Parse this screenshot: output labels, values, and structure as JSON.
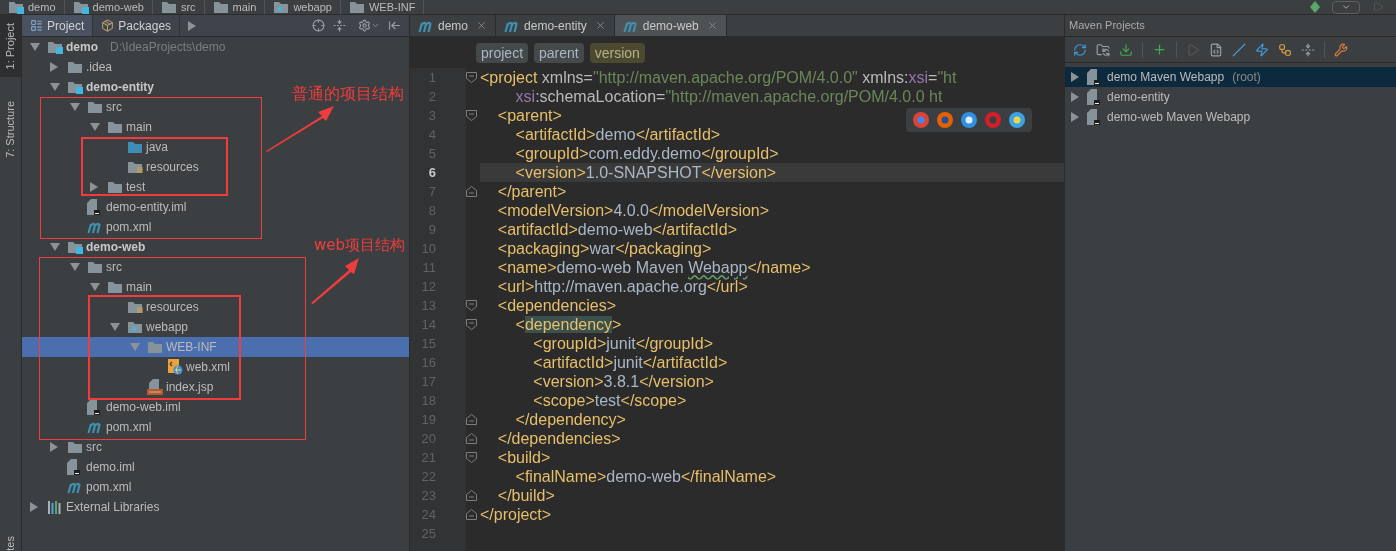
{
  "breadcrumbs": [
    {
      "label": "demo",
      "kind": "module"
    },
    {
      "label": "demo-web",
      "kind": "module"
    },
    {
      "label": "src",
      "kind": "folder"
    },
    {
      "label": "main",
      "kind": "folder"
    },
    {
      "label": "webapp",
      "kind": "web"
    },
    {
      "label": "WEB-INF",
      "kind": "folder"
    }
  ],
  "side_strip": {
    "tabs": [
      {
        "label": "1: Project",
        "selected": true
      },
      {
        "label": "7: Structure",
        "selected": false
      }
    ],
    "bottom_label": "tes"
  },
  "project_panel": {
    "tabs": [
      {
        "label": "Project",
        "selected": true
      },
      {
        "label": "Packages",
        "selected": false
      }
    ],
    "tree": [
      {
        "label": "demo",
        "path": "D:\\IdeaProjects\\demo",
        "kind": "module",
        "expanded": true,
        "selected": false,
        "children": [
          {
            "label": ".idea",
            "kind": "folder",
            "expanded": false,
            "selected": false
          },
          {
            "label": "demo-entity",
            "kind": "module",
            "expanded": true,
            "selected": false,
            "children": [
              {
                "label": "src",
                "kind": "folder",
                "expanded": true,
                "selected": false,
                "children": [
                  {
                    "label": "main",
                    "kind": "folder",
                    "expanded": true,
                    "selected": false,
                    "children": [
                      {
                        "label": "java",
                        "kind": "source",
                        "selected": false
                      },
                      {
                        "label": "resources",
                        "kind": "resources",
                        "selected": false
                      }
                    ]
                  },
                  {
                    "label": "test",
                    "kind": "folder",
                    "expanded": false,
                    "selected": false
                  }
                ]
              },
              {
                "label": "demo-entity.iml",
                "kind": "iml",
                "selected": false
              },
              {
                "label": "pom.xml",
                "kind": "pom",
                "selected": false
              }
            ]
          },
          {
            "label": "demo-web",
            "kind": "module",
            "expanded": true,
            "selected": false,
            "children": [
              {
                "label": "src",
                "kind": "folder",
                "expanded": true,
                "selected": false,
                "children": [
                  {
                    "label": "main",
                    "kind": "folder",
                    "expanded": true,
                    "selected": false,
                    "children": [
                      {
                        "label": "resources",
                        "kind": "resources",
                        "selected": false
                      },
                      {
                        "label": "webapp",
                        "kind": "web",
                        "expanded": true,
                        "selected": false,
                        "children": [
                          {
                            "label": "WEB-INF",
                            "kind": "folder",
                            "expanded": true,
                            "selected": true,
                            "children": [
                              {
                                "label": "web.xml",
                                "kind": "webxml",
                                "selected": false
                              }
                            ]
                          },
                          {
                            "label": "index.jsp",
                            "kind": "jsp",
                            "selected": false
                          }
                        ]
                      }
                    ]
                  }
                ]
              },
              {
                "label": "demo-web.iml",
                "kind": "iml",
                "selected": false
              },
              {
                "label": "pom.xml",
                "kind": "pom",
                "selected": false
              }
            ]
          },
          {
            "label": "src",
            "kind": "folder",
            "expanded": false,
            "selected": false
          },
          {
            "label": "demo.iml",
            "kind": "iml",
            "selected": false
          },
          {
            "label": "pom.xml",
            "kind": "pom",
            "selected": false
          }
        ]
      },
      {
        "label": "External Libraries",
        "kind": "libraries",
        "expanded": false,
        "selected": false
      }
    ]
  },
  "editor": {
    "tabs": [
      {
        "label": "demo",
        "selected": false
      },
      {
        "label": "demo-entity",
        "selected": false
      },
      {
        "label": "demo-web",
        "selected": true
      }
    ],
    "breadcrumbs": [
      {
        "label": "project",
        "selected": false
      },
      {
        "label": "parent",
        "selected": false
      },
      {
        "label": "version",
        "selected": true
      }
    ],
    "lines": [
      {
        "number": "1",
        "current": false,
        "kind": "fold_start",
        "tokens": [
          {
            "kind": "tag",
            "text": "<project"
          },
          {
            "kind": "attr",
            "text": " xmlns="
          },
          {
            "kind": "value",
            "text": "\"http://maven.apache.org/POM/4.0.0\""
          },
          {
            "kind": "attr",
            "text": " xmlns:"
          },
          {
            "kind": "ns",
            "text": "xsi"
          },
          {
            "kind": "attr",
            "text": "="
          },
          {
            "kind": "value",
            "text": "\"ht"
          }
        ]
      },
      {
        "number": "2",
        "current": false,
        "kind": "plain",
        "tokens": [
          {
            "kind": "ns",
            "text": "        xsi"
          },
          {
            "kind": "attr",
            "text": ":schemaLocation="
          },
          {
            "kind": "value",
            "text": "\"http://maven.apache.org/POM/4.0.0 ht"
          }
        ]
      },
      {
        "number": "3",
        "current": false,
        "kind": "fold_start",
        "tokens": [
          {
            "kind": "tag",
            "text": "    <parent>"
          }
        ]
      },
      {
        "number": "4",
        "current": false,
        "kind": "plain",
        "tokens": [
          {
            "kind": "tag",
            "text": "        <artifactId>"
          },
          {
            "kind": "text",
            "text": "demo"
          },
          {
            "kind": "tag",
            "text": "</artifactId>"
          }
        ]
      },
      {
        "number": "5",
        "current": false,
        "kind": "plain",
        "tokens": [
          {
            "kind": "tag",
            "text": "        <groupId>"
          },
          {
            "kind": "text",
            "text": "com.eddy.demo"
          },
          {
            "kind": "tag",
            "text": "</groupId>"
          }
        ]
      },
      {
        "number": "6",
        "current": true,
        "kind": "plain",
        "tokens": [
          {
            "kind": "tag",
            "text": "        <version>"
          },
          {
            "kind": "text",
            "text": "1.0-SNAPSHOT"
          },
          {
            "kind": "tag",
            "text": "</version>"
          }
        ]
      },
      {
        "number": "7",
        "current": false,
        "kind": "fold_end",
        "tokens": [
          {
            "kind": "tag",
            "text": "    </parent>"
          }
        ]
      },
      {
        "number": "8",
        "current": false,
        "kind": "plain",
        "tokens": [
          {
            "kind": "tag",
            "text": "    <modelVersion>"
          },
          {
            "kind": "text",
            "text": "4.0.0"
          },
          {
            "kind": "tag",
            "text": "</modelVersion>"
          }
        ]
      },
      {
        "number": "9",
        "current": false,
        "kind": "plain",
        "tokens": [
          {
            "kind": "tag",
            "text": "    <artifactId>"
          },
          {
            "kind": "text",
            "text": "demo-web"
          },
          {
            "kind": "tag",
            "text": "</artifactId>"
          }
        ]
      },
      {
        "number": "10",
        "current": false,
        "kind": "plain",
        "tokens": [
          {
            "kind": "tag",
            "text": "    <packaging>"
          },
          {
            "kind": "text",
            "text": "war"
          },
          {
            "kind": "tag",
            "text": "</packaging>"
          }
        ]
      },
      {
        "number": "11",
        "current": false,
        "kind": "plain",
        "tokens": [
          {
            "kind": "tag",
            "text": "    <name>"
          },
          {
            "kind": "text",
            "text": "demo-web Maven "
          },
          {
            "kind": "typo",
            "text": "Webapp"
          },
          {
            "kind": "tag",
            "text": "</name>"
          }
        ]
      },
      {
        "number": "12",
        "current": false,
        "kind": "plain",
        "tokens": [
          {
            "kind": "tag",
            "text": "    <url>"
          },
          {
            "kind": "text",
            "text": "http://maven.apache.org"
          },
          {
            "kind": "tag",
            "text": "</url>"
          }
        ]
      },
      {
        "number": "13",
        "current": false,
        "kind": "fold_start",
        "tokens": [
          {
            "kind": "tag",
            "text": "    <dependencies>"
          }
        ]
      },
      {
        "number": "14",
        "current": false,
        "kind": "fold_start",
        "tokens": [
          {
            "kind": "tag",
            "text": "        <"
          },
          {
            "kind": "match",
            "text": "dependency"
          },
          {
            "kind": "tag",
            "text": ">"
          }
        ]
      },
      {
        "number": "15",
        "current": false,
        "kind": "plain",
        "tokens": [
          {
            "kind": "tag",
            "text": "            <groupId>"
          },
          {
            "kind": "text",
            "text": "junit"
          },
          {
            "kind": "tag",
            "text": "</groupId>"
          }
        ]
      },
      {
        "number": "16",
        "current": false,
        "kind": "plain",
        "tokens": [
          {
            "kind": "tag",
            "text": "            <artifactId>"
          },
          {
            "kind": "text",
            "text": "junit"
          },
          {
            "kind": "tag",
            "text": "</artifactId>"
          }
        ]
      },
      {
        "number": "17",
        "current": false,
        "kind": "plain",
        "tokens": [
          {
            "kind": "tag",
            "text": "            <version>"
          },
          {
            "kind": "text",
            "text": "3.8.1"
          },
          {
            "kind": "tag",
            "text": "</version>"
          }
        ]
      },
      {
        "number": "18",
        "current": false,
        "kind": "plain",
        "tokens": [
          {
            "kind": "tag",
            "text": "            <scope>"
          },
          {
            "kind": "text",
            "text": "test"
          },
          {
            "kind": "tag",
            "text": "</scope>"
          }
        ]
      },
      {
        "number": "19",
        "current": false,
        "kind": "fold_end",
        "tokens": [
          {
            "kind": "tag",
            "text": "        </dependency>"
          }
        ]
      },
      {
        "number": "20",
        "current": false,
        "kind": "fold_end",
        "tokens": [
          {
            "kind": "tag",
            "text": "    </dependencies>"
          }
        ]
      },
      {
        "number": "21",
        "current": false,
        "kind": "fold_start",
        "tokens": [
          {
            "kind": "tag",
            "text": "    <build>"
          }
        ]
      },
      {
        "number": "22",
        "current": false,
        "kind": "plain",
        "tokens": [
          {
            "kind": "tag",
            "text": "        <finalName>"
          },
          {
            "kind": "text",
            "text": "demo-web"
          },
          {
            "kind": "tag",
            "text": "</finalName>"
          }
        ]
      },
      {
        "number": "23",
        "current": false,
        "kind": "fold_end",
        "tokens": [
          {
            "kind": "tag",
            "text": "    </build>"
          }
        ]
      },
      {
        "number": "24",
        "current": false,
        "kind": "fold_end",
        "tokens": [
          {
            "kind": "tag",
            "text": "</project>"
          }
        ]
      },
      {
        "number": "25",
        "current": false,
        "kind": "plain"
      }
    ]
  },
  "maven_panel": {
    "title": "Maven Projects",
    "tree": [
      {
        "label": "demo Maven Webapp",
        "note": "(root)",
        "selected": true,
        "expanded": false
      },
      {
        "label": "demo-entity",
        "selected": false,
        "expanded": false
      },
      {
        "label": "demo-web Maven Webapp",
        "selected": false,
        "expanded": false
      }
    ]
  },
  "annotations": [
    {
      "text": "普通的项目结构"
    },
    {
      "text": "web项目结构"
    }
  ]
}
